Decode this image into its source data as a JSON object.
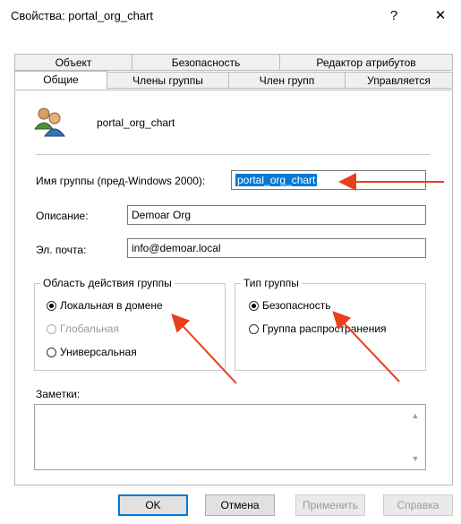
{
  "window": {
    "title": "Свойства: portal_org_chart",
    "help": "?",
    "close": "✕"
  },
  "tabs": {
    "row1": [
      "Объект",
      "Безопасность",
      "Редактор атрибутов"
    ],
    "row2": [
      "Общие",
      "Члены группы",
      "Член групп",
      "Управляется"
    ],
    "active": "Общие"
  },
  "general": {
    "name": "portal_org_chart",
    "pre2000_label": "Имя группы (пред-Windows 2000):",
    "pre2000_value": "portal_org_chart",
    "description_label": "Описание:",
    "description_value": "Demoar Org",
    "email_label": "Эл. почта:",
    "email_value": "info@demoar.local",
    "scope": {
      "title": "Область действия группы",
      "options": [
        "Локальная в домене",
        "Глобальная",
        "Универсальная"
      ],
      "selected": "Локальная в домене",
      "disabled": [
        "Глобальная"
      ]
    },
    "type": {
      "title": "Тип группы",
      "options": [
        "Безопасность",
        "Группа распространения"
      ],
      "selected": "Безопасность"
    },
    "notes_label": "Заметки:",
    "notes_value": ""
  },
  "buttons": {
    "ok": "OK",
    "cancel": "Отмена",
    "apply": "Применить",
    "help": "Справка"
  },
  "annotation_color": "#e8401c"
}
